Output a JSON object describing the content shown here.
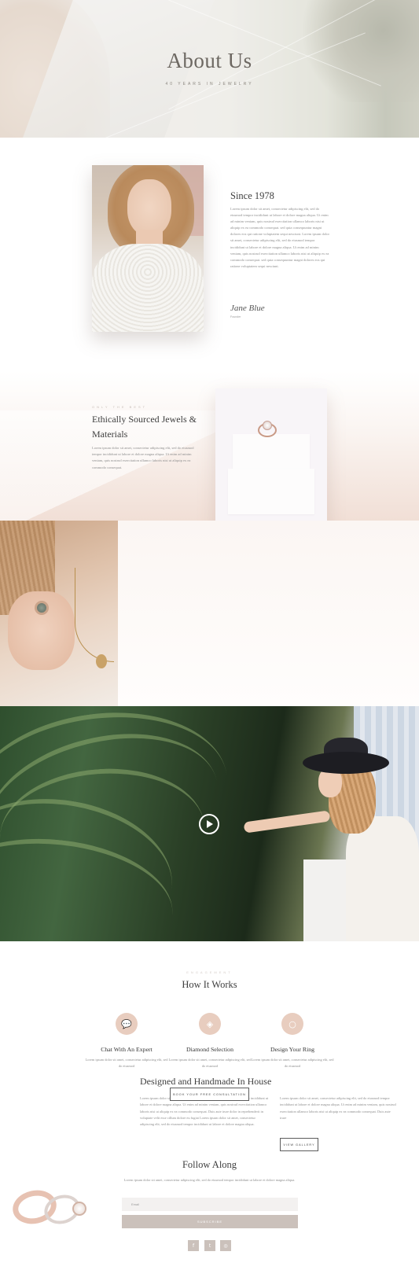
{
  "hero": {
    "title": "About Us",
    "subtitle": "40 YEARS IN JEWELRY"
  },
  "about": {
    "title": "Since 1978",
    "body": "Lorem ipsum dolor sit amet, consectetur adipiscing elit, sed do eiusmod tempor incididunt ut labore et dolore magna aliqua. Ut enim ad minim veniam, quis nostrud exercitation ullamco laboris nisi ut aliquip ex ea commodo consequat. sed quia consequuntur magni dolores eos qui ratione voluptatem sequi nesciunt. Lorem ipsum dolor sit amet, consectetur adipiscing elit, sed do eiusmod tempor incididunt ut labore et dolore magna aliqua. Ut enim ad minim veniam, quis nostrud exercitation ullamco laboris nisi ut aliquip ex ea commodo consequat. sed quia consequuntur magni dolores eos qui ratione voluptatem sequi nesciunt.",
    "signature": "Jane Blue",
    "role": "Founder"
  },
  "ethical": {
    "kicker": "ONLY THE BEST",
    "title": "Ethically Sourced Jewels & Materials",
    "body": "Lorem ipsum dolor sit amet, consectetur adipiscing elit, sed do eiusmod tempor incididunt ut labore et dolore magna aliqua. Ut enim ad minim veniam, quis nostrud exercitation ullamco laboris nisi ut aliquip ex ea commodo consequat."
  },
  "designed": {
    "title": "Designed and Handmade In House",
    "col1": "Lorem ipsum dolor sit amet, consectetur adipiscing elit, sed do eiusmod tempor incididunt ut labore et dolore magna aliqua. Ut enim ad minim veniam, quis nostrud exercitation ullamco laboris nisi ut aliquip ex ea commodo consequat. Duis aute irure dolor in reprehenderit in voluptate velit esse cillum dolore eu fugiat Lorem ipsum dolor sit amet, consectetur adipiscing elit, sed do eiusmod tempor incididunt ut labore et dolore magna aliqua.",
    "col2": "Lorem ipsum dolor sit amet, consectetur adipiscing elit, sed do eiusmod tempor incididunt ut labore et dolore magna aliqua. Ut enim ad minim veniam, quis nostrud exercitation ullamco laboris nisi ut aliquip ex ea commodo consequat. Duis aute irure",
    "button": "VIEW GALLERY"
  },
  "video": {
    "play_icon": "play-icon"
  },
  "how": {
    "kicker": "ENGAGEMENT",
    "title": "How It Works",
    "steps": [
      {
        "icon": "chat-icon",
        "title": "Chat With An Expert",
        "body": "Lorem ipsum dolor sit amet, consectetur adipiscing elit, sed do eiusmod"
      },
      {
        "icon": "diamond-icon",
        "title": "Diamond Selection",
        "body": "Lorem ipsum dolor sit amet, consectetur adipiscing elit, sed do eiusmod"
      },
      {
        "icon": "ring-icon",
        "title": "Design Your Ring",
        "body": "Lorem ipsum dolor sit amet, consectetur adipiscing elit, sed do eiusmod"
      }
    ],
    "button": "BOOK YOUR FREE CONSULTATION"
  },
  "follow": {
    "title": "Follow Along",
    "body": "Lorem ipsum dolor sit amet, consectetur adipiscing elit, sed do eiusmod tempor incididunt ut labore et dolore magna aliqua.",
    "email_placeholder": "Email",
    "subscribe": "SUBSCRIBE",
    "social": [
      "f",
      "t",
      "◎"
    ]
  },
  "colors": {
    "accent": "#e8cdbf",
    "button_fill": "#cbc1bb",
    "text": "#3e3e3e"
  }
}
